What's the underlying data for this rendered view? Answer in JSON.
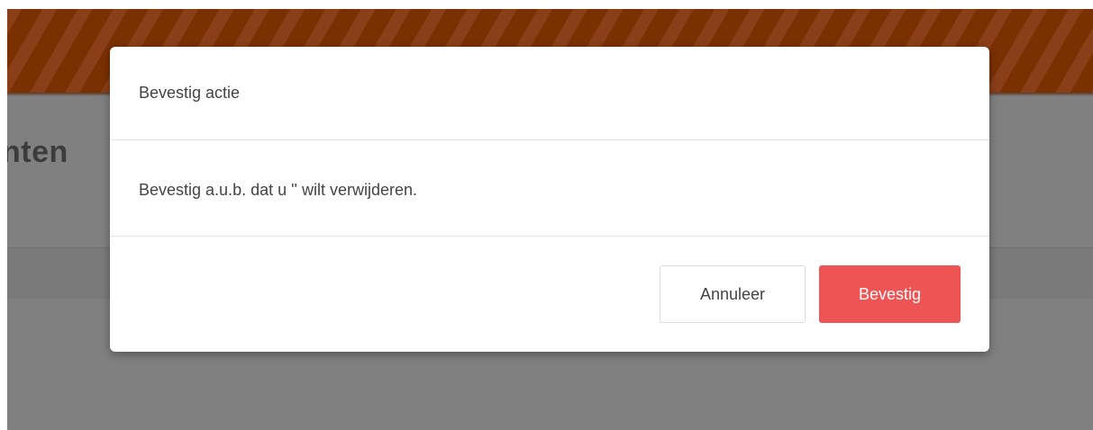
{
  "background": {
    "heading_fragment": "nten",
    "colors": {
      "banner": "#7a3000",
      "overlay": "#808080"
    }
  },
  "modal": {
    "title": "Bevestig actie",
    "message": "Bevestig a.u.b. dat u '' wilt verwijderen.",
    "buttons": {
      "cancel_label": "Annuleer",
      "confirm_label": "Bevestig"
    },
    "colors": {
      "confirm": "#ef5454",
      "text": "#444444"
    }
  }
}
